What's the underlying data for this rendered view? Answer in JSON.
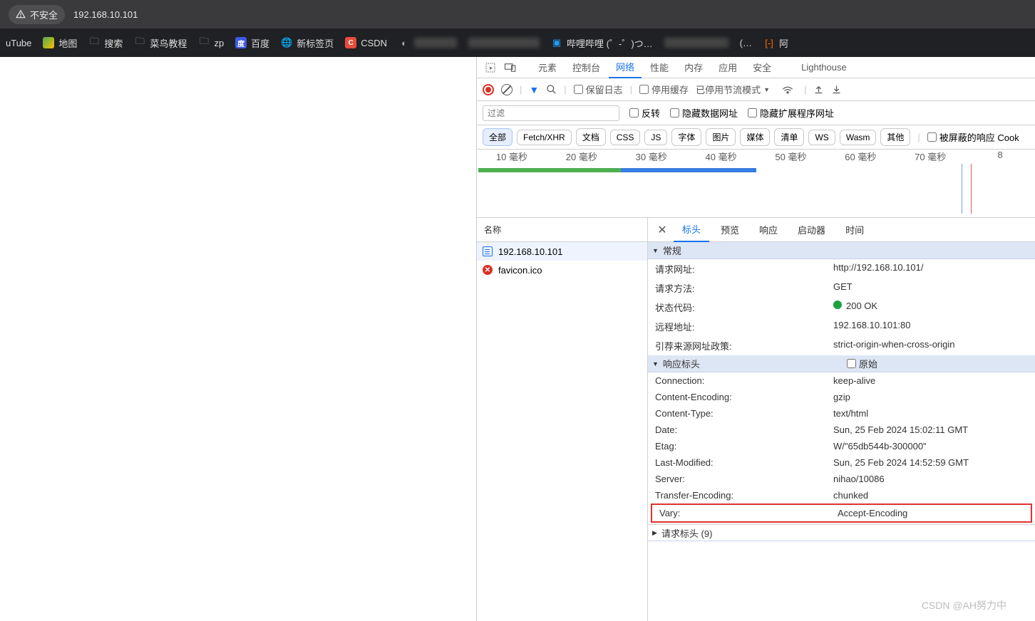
{
  "address_bar": {
    "security": "不安全",
    "url": "192.168.10.101"
  },
  "bookmarks": {
    "items": [
      "uTube",
      "地图",
      "搜索",
      "菜鸟教程",
      "zp",
      "百度",
      "新标签页",
      "CSDN"
    ],
    "bili": "哔哩哔哩 (゜-゜)つ…",
    "ellipsis": "(…",
    "ali": "阿"
  },
  "devtools": {
    "tabs": [
      "元素",
      "控制台",
      "网络",
      "性能",
      "内存",
      "应用",
      "安全",
      "Lighthouse"
    ],
    "active_tab": "网络",
    "toolbar": {
      "preserve": "保留日志",
      "cache": "停用缓存",
      "throttle": "已停用节流模式"
    },
    "filter_row": {
      "placeholder": "过滤",
      "invert": "反转",
      "hide_data": "隐藏数据网址",
      "hide_ext": "隐藏扩展程序网址"
    },
    "types": [
      "全部",
      "Fetch/XHR",
      "文档",
      "CSS",
      "JS",
      "字体",
      "图片",
      "媒体",
      "清单",
      "WS",
      "Wasm",
      "其他"
    ],
    "blocked": "被屏蔽的响应 Cook",
    "timeline_labels": [
      "10 毫秒",
      "20 毫秒",
      "30 毫秒",
      "40 毫秒",
      "50 毫秒",
      "60 毫秒",
      "70 毫秒",
      "8"
    ],
    "req_list": {
      "header": "名称",
      "items": [
        {
          "name": "192.168.10.101",
          "icon": "doc"
        },
        {
          "name": "favicon.ico",
          "icon": "err"
        }
      ]
    },
    "detail_tabs": [
      "标头",
      "预览",
      "响应",
      "启动器",
      "时间"
    ],
    "sections": {
      "general": {
        "title": "常规",
        "rows": [
          {
            "k": "请求网址:",
            "v": "http://192.168.10.101/"
          },
          {
            "k": "请求方法:",
            "v": "GET"
          },
          {
            "k": "状态代码:",
            "v": "200 OK",
            "status": true
          },
          {
            "k": "远程地址:",
            "v": "192.168.10.101:80"
          },
          {
            "k": "引荐来源网址政策:",
            "v": "strict-origin-when-cross-origin"
          }
        ]
      },
      "response": {
        "title": "响应标头",
        "raw": "原始",
        "rows": [
          {
            "k": "Connection:",
            "v": "keep-alive"
          },
          {
            "k": "Content-Encoding:",
            "v": "gzip"
          },
          {
            "k": "Content-Type:",
            "v": "text/html"
          },
          {
            "k": "Date:",
            "v": "Sun, 25 Feb 2024 15:02:11 GMT"
          },
          {
            "k": "Etag:",
            "v": "W/\"65db544b-300000\""
          },
          {
            "k": "Last-Modified:",
            "v": "Sun, 25 Feb 2024 14:52:59 GMT"
          },
          {
            "k": "Server:",
            "v": "nihao/10086"
          },
          {
            "k": "Transfer-Encoding:",
            "v": "chunked"
          },
          {
            "k": "Vary:",
            "v": "Accept-Encoding",
            "hl": true
          }
        ]
      },
      "request": {
        "title": "请求标头 (9)"
      }
    }
  },
  "watermark": "CSDN @AH努力中"
}
